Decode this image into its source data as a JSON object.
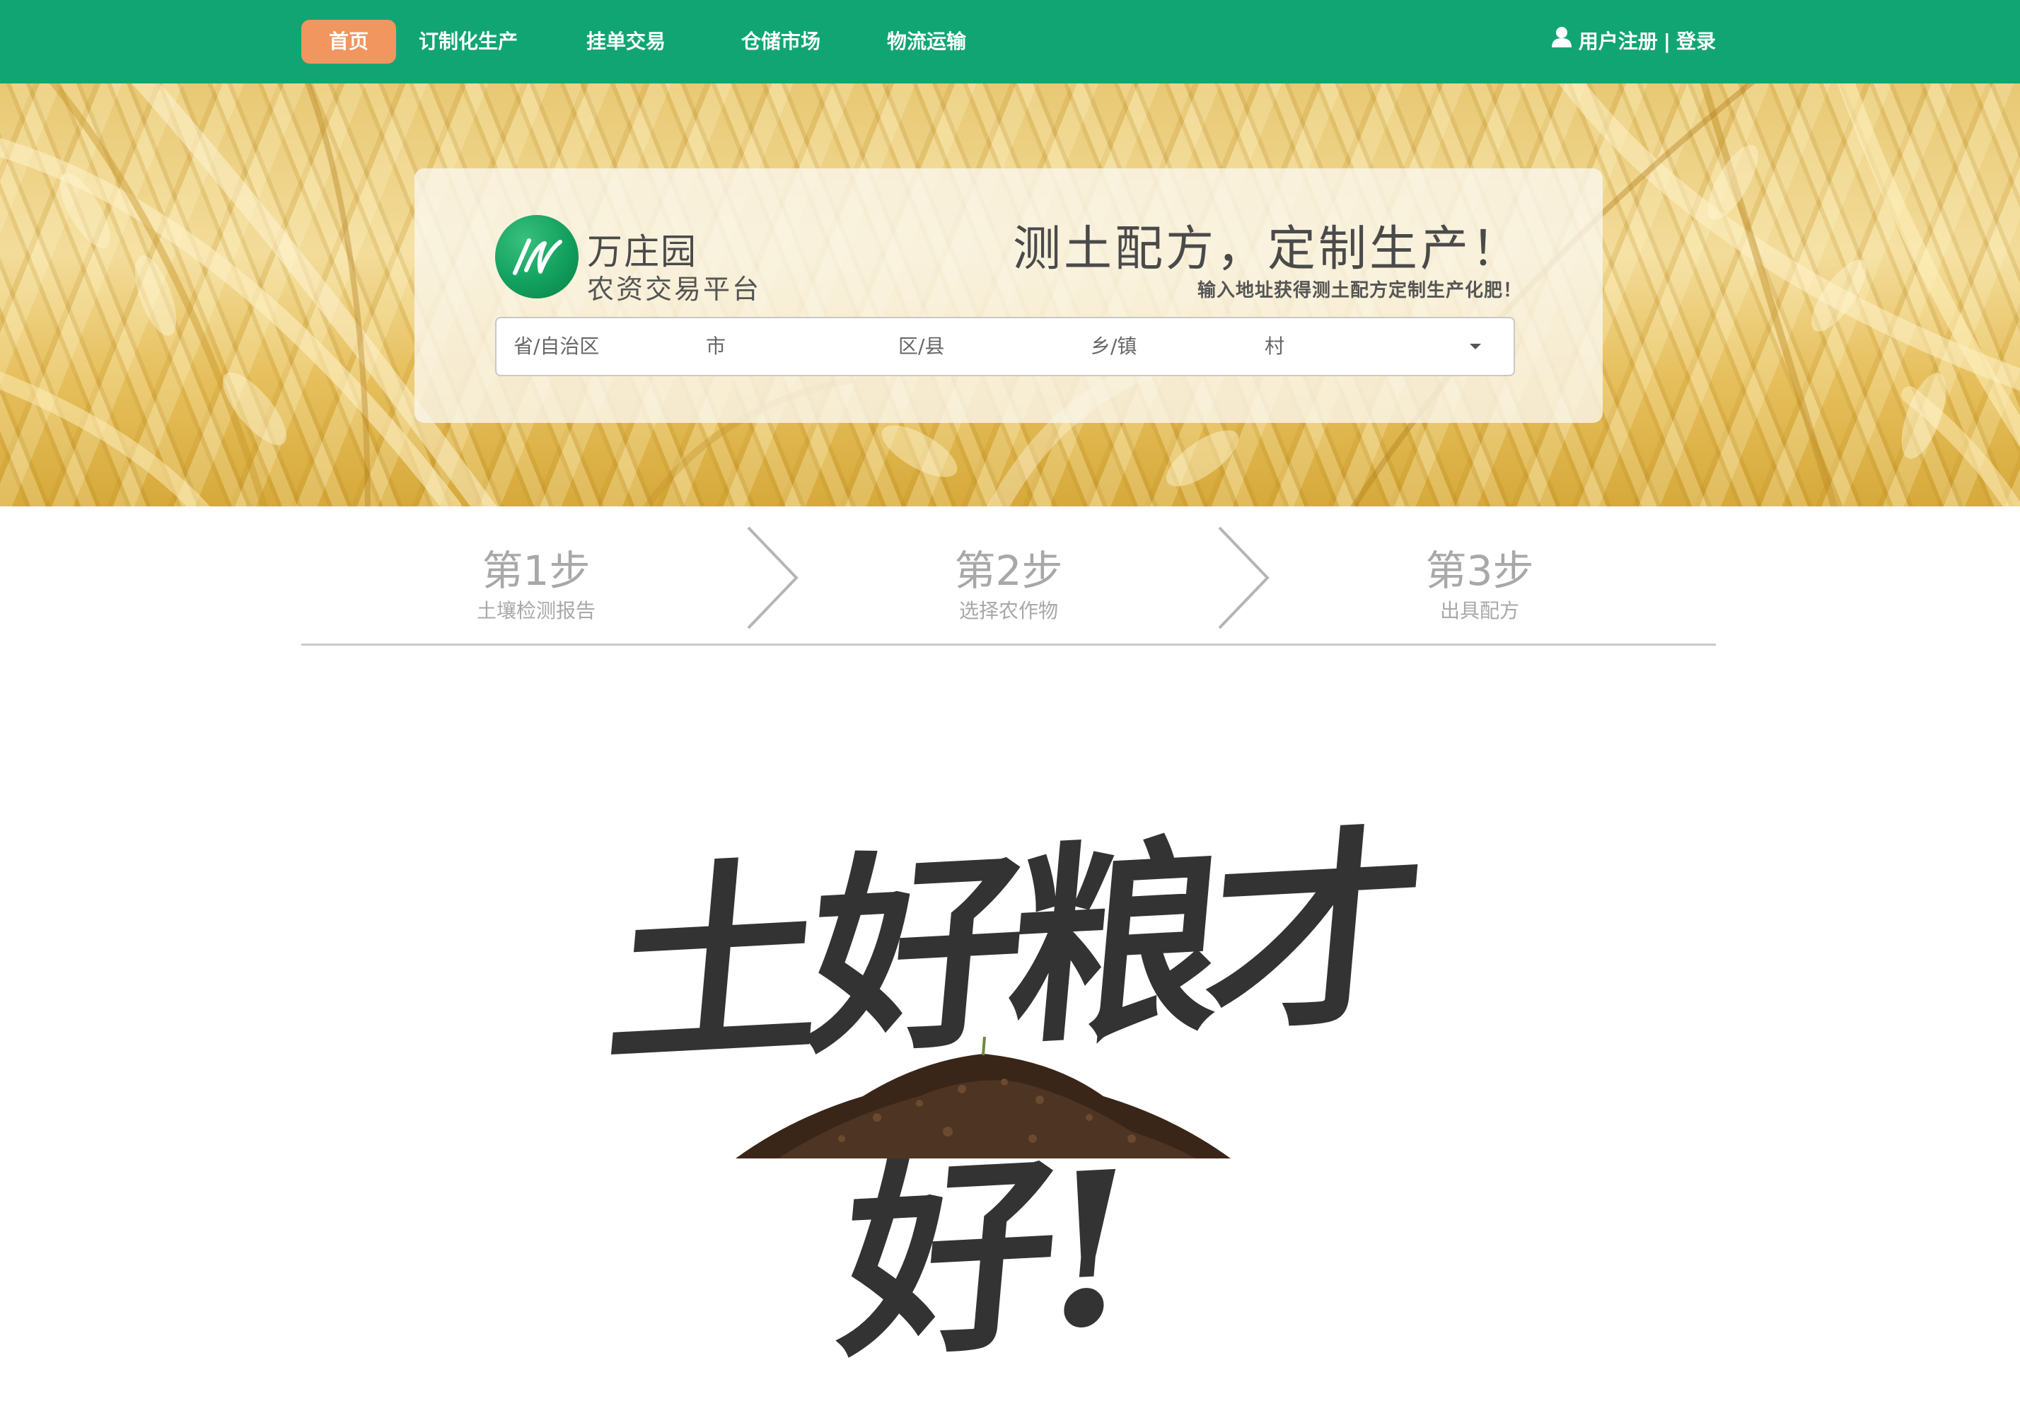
{
  "nav": {
    "items": [
      {
        "label": "首页",
        "active": true
      },
      {
        "label": "订制化生产"
      },
      {
        "label": "挂单交易"
      },
      {
        "label": "仓储市场"
      },
      {
        "label": "物流运输"
      }
    ],
    "register_label": "用户注册",
    "separator": "|",
    "login_label": "登录",
    "user_icon": "user-icon"
  },
  "hero": {
    "logo_name": "万庄园",
    "logo_sub": "农资交易平台",
    "slogan": "测土配方，定制生产！",
    "slogan_sub": "输入地址获得测土配方定制生产化肥！",
    "address": {
      "province_placeholder": "省/自治区",
      "city_placeholder": "市",
      "district_placeholder": "区/县",
      "town_placeholder": "乡/镇",
      "village_placeholder": "村"
    }
  },
  "steps": [
    {
      "title": "第1步",
      "desc": "土壤检测报告"
    },
    {
      "title": "第2步",
      "desc": "选择农作物"
    },
    {
      "title": "第3步",
      "desc": "出具配方"
    }
  ],
  "banner": {
    "calligraphy": "土好粮才好!"
  },
  "colors": {
    "nav_bg": "#12a574",
    "active_tab": "#f0965e",
    "step_text": "#a8a8a8"
  }
}
